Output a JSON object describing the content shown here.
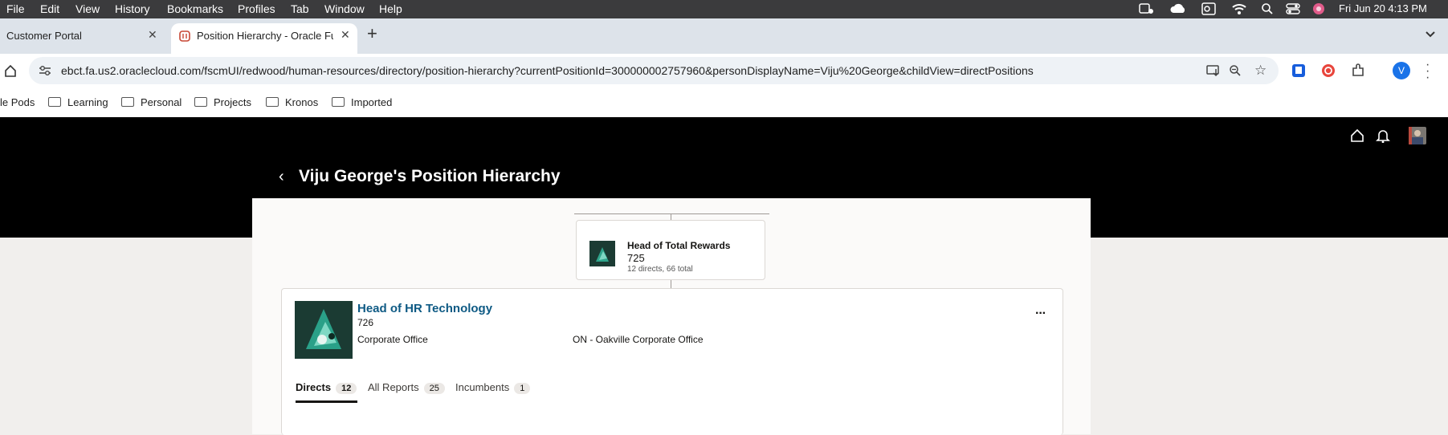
{
  "menubar": {
    "items": [
      "File",
      "Edit",
      "View",
      "History",
      "Bookmarks",
      "Profiles",
      "Tab",
      "Window",
      "Help"
    ],
    "datetime": "Fri Jun 20  4:13 PM"
  },
  "tabs": [
    {
      "title": "Customer Portal",
      "close": "✕"
    },
    {
      "title": "Position Hierarchy - Oracle Fu",
      "close": "✕"
    }
  ],
  "new_tab": "+",
  "address": {
    "url": "ebct.fa.us2.oraclecloud.com/fscmUI/redwood/human-resources/directory/position-hierarchy?currentPositionId=300000002757960&personDisplayName=Viju%20George&childView=directPositions"
  },
  "profile_initial": "V",
  "bookmarks": [
    "le Pods",
    "Learning",
    "Personal",
    "Projects",
    "Kronos",
    "Imported"
  ],
  "page": {
    "title": "Viju George's Position Hierarchy",
    "back": "‹"
  },
  "parent": {
    "title": "Head of Total Rewards",
    "number": "725",
    "counts": "12 directs, 66 total"
  },
  "current": {
    "title": "Head of HR Technology",
    "number": "726",
    "department": "Corporate Office",
    "location": "ON - Oakville Corporate Office",
    "more": "···"
  },
  "view_tabs": [
    {
      "label": "Directs",
      "count": "12"
    },
    {
      "label": "All Reports",
      "count": "25"
    },
    {
      "label": "Incumbents",
      "count": "1"
    }
  ],
  "colors": {
    "link": "#0e5a84",
    "header_bg": "#000000",
    "page_bg": "#f1efed"
  }
}
